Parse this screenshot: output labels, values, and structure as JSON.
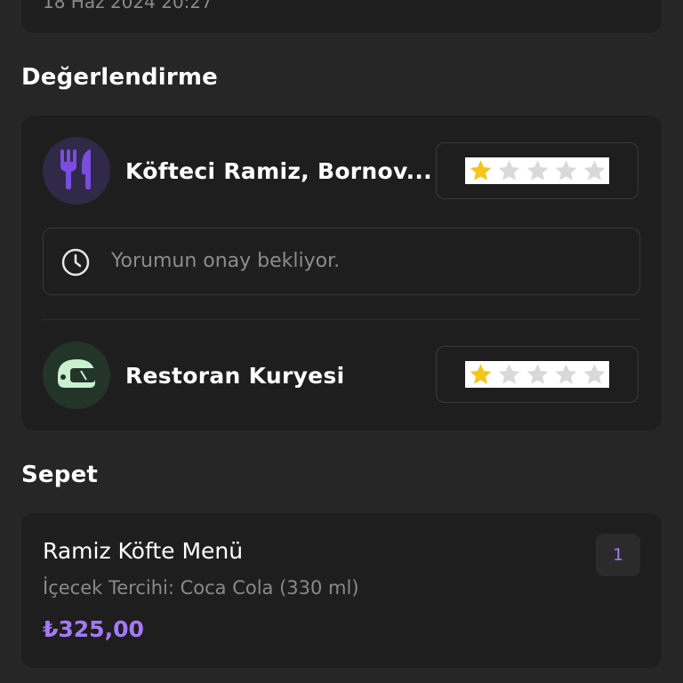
{
  "order": {
    "date_text": "18 Haz 2024 20:27"
  },
  "rating": {
    "title": "Değerlendirme",
    "restaurant": {
      "name": "Köfteci Ramiz, Bornov...",
      "icon": "fork-knife-icon",
      "stars_selected": 1,
      "stars_total": 5
    },
    "pending_message": "Yorumun onay bekliyor.",
    "courier": {
      "name": "Restoran Kuryesi",
      "icon": "courier-helmet-icon",
      "stars_selected": 1,
      "stars_total": 5
    }
  },
  "basket": {
    "title": "Sepet",
    "items": [
      {
        "name": "Ramiz Köfte Menü",
        "option": "İçecek Tercihi: Coca Cola (330 ml)",
        "price": "₺325,00",
        "quantity": "1"
      }
    ]
  },
  "colors": {
    "background": "#262626",
    "card": "#1e1e1e",
    "accent_purple": "#a679ff",
    "star_active": "#f5c518",
    "star_inactive": "#d9d9d9"
  }
}
